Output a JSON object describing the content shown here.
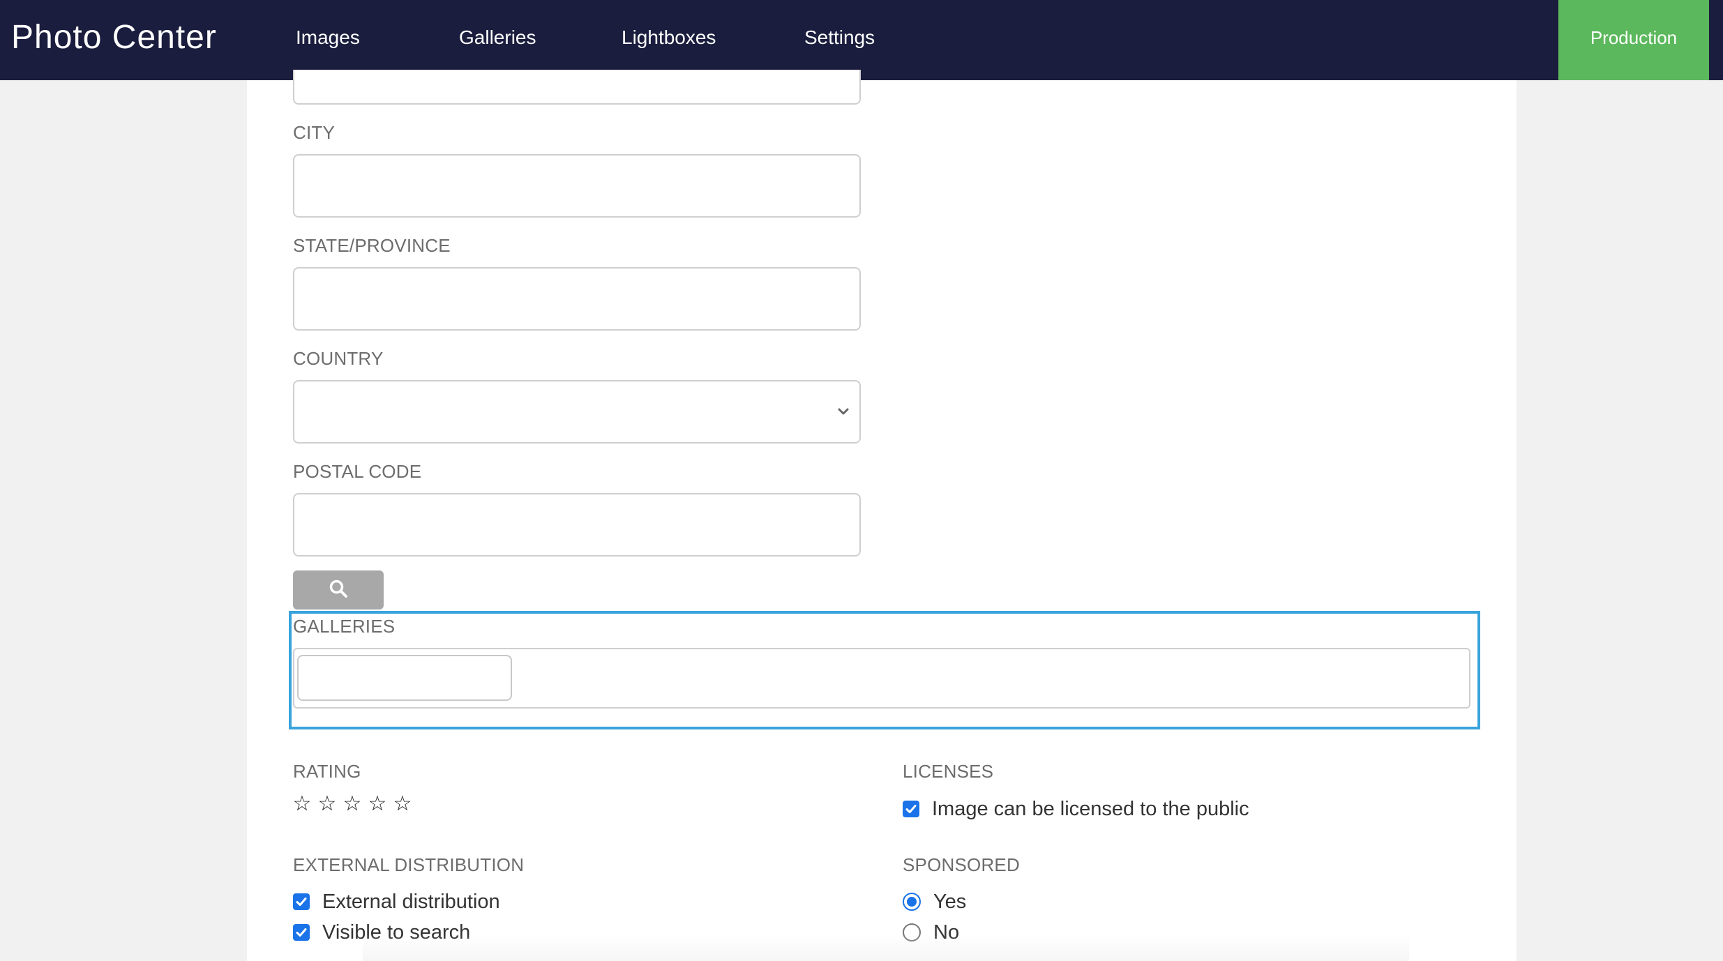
{
  "app": {
    "title": "Photo Center",
    "environment": "Production",
    "nav": [
      {
        "label": "Images"
      },
      {
        "label": "Galleries"
      },
      {
        "label": "Lightboxes"
      },
      {
        "label": "Settings"
      }
    ]
  },
  "form": {
    "city": {
      "label": "CITY",
      "value": ""
    },
    "state": {
      "label": "STATE/PROVINCE",
      "value": ""
    },
    "country": {
      "label": "COUNTRY",
      "selected": ""
    },
    "postal_code": {
      "label": "POSTAL CODE",
      "value": ""
    },
    "search_icon": "search-icon",
    "galleries": {
      "label": "GALLERIES",
      "value": ""
    },
    "rating": {
      "label": "RATING",
      "stars": 5,
      "value": 0,
      "glyph": "☆"
    },
    "licenses": {
      "label": "LICENSES",
      "option": {
        "label": "Image can be licensed to the public",
        "checked": true
      }
    },
    "external_distribution": {
      "label": "EXTERNAL DISTRIBUTION",
      "options": [
        {
          "label": "External distribution",
          "checked": true
        },
        {
          "label": "Visible to search",
          "checked": true
        }
      ]
    },
    "sponsored": {
      "label": "SPONSORED",
      "options": [
        {
          "label": "Yes",
          "selected": true
        },
        {
          "label": "No",
          "selected": false
        }
      ]
    }
  },
  "colors": {
    "navbar": "#1a1d3d",
    "environment_badge": "#5cb85c",
    "focus_outline": "#39a3dc",
    "accent": "#1a73e8",
    "search_button": "#a8a8a8"
  }
}
